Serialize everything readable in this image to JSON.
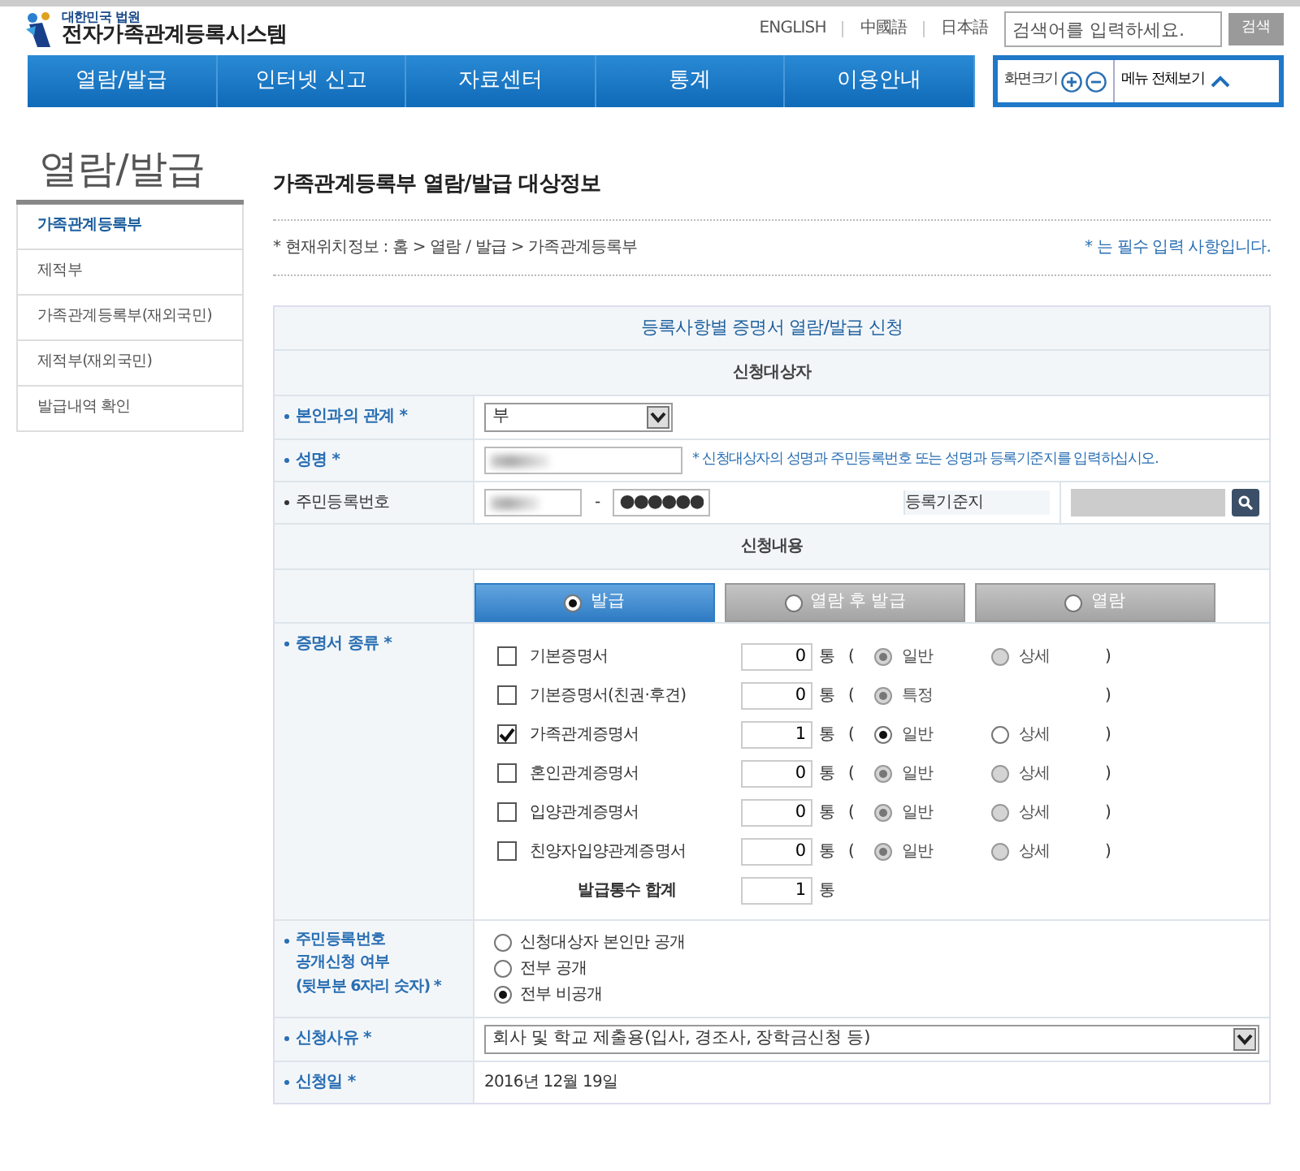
{
  "header": {
    "org": "대한민국 법원",
    "title": "전자가족관계등록시스템",
    "languages": [
      "ENGLISH",
      "中國語",
      "日本語"
    ],
    "search": {
      "placeholder": "검색어를 입력하세요.",
      "button": "검색"
    }
  },
  "nav": [
    "열람/발급",
    "인터넷 신고",
    "자료센터",
    "통계",
    "이용안내"
  ],
  "tools": {
    "zoom_label": "화면크기",
    "menu_label": "메뉴 전체보기"
  },
  "sidebar": {
    "title": "열람/발급",
    "items": [
      {
        "label": "가족관계등록부",
        "selected": true
      },
      {
        "label": "제적부",
        "selected": false
      },
      {
        "label": "가족관계등록부(재외국민)",
        "selected": false
      },
      {
        "label": "제적부(재외국민)",
        "selected": false
      },
      {
        "label": "발급내역 확인",
        "selected": false
      }
    ]
  },
  "page": {
    "title": "가족관계등록부 열람/발급 대상정보",
    "breadcrumb": "* 현재위치정보 : 홈 > 열람 / 발급 > 가족관계등록부",
    "required_note": "* 는 필수 입력 사항입니다."
  },
  "form": {
    "title": "등록사항별 증명서 열람/발급 신청",
    "section_subject": "신청대상자",
    "relation": {
      "label": "본인과의 관계 *",
      "required": true,
      "value": "부"
    },
    "name": {
      "label": "성명 *",
      "required": true,
      "hint": "* 신청대상자의 성명과 주민등록번호 또는 성명과 등록기준지를 입력하십시오."
    },
    "rrn": {
      "label": "주민등록번호",
      "required": false,
      "separator": "-",
      "back": "●●●●●●"
    },
    "domicile": {
      "label": "등록기준지",
      "required": false
    },
    "section_request": "신청내용",
    "modes": [
      {
        "label": "발급",
        "selected": true
      },
      {
        "label": "열람 후 발급",
        "selected": false
      },
      {
        "label": "열람",
        "selected": false
      }
    ],
    "certificates": {
      "label": "증명서 종류 *",
      "required": true,
      "rows": [
        {
          "label": "기본증명서",
          "checked": false,
          "count": "0",
          "unit": "통",
          "open": "(",
          "close": ")",
          "options": [
            {
              "label": "일반",
              "selected": true,
              "disabled": true
            },
            {
              "label": "상세",
              "selected": false,
              "disabled": true
            }
          ]
        },
        {
          "label": "기본증명서(친권·후견)",
          "checked": false,
          "count": "0",
          "unit": "통",
          "open": "(",
          "close": ")",
          "options": [
            {
              "label": "특정",
              "selected": true,
              "disabled": true
            }
          ]
        },
        {
          "label": "가족관계증명서",
          "checked": true,
          "count": "1",
          "unit": "통",
          "open": "(",
          "close": ")",
          "options": [
            {
              "label": "일반",
              "selected": true,
              "disabled": false
            },
            {
              "label": "상세",
              "selected": false,
              "disabled": false
            }
          ]
        },
        {
          "label": "혼인관계증명서",
          "checked": false,
          "count": "0",
          "unit": "통",
          "open": "(",
          "close": ")",
          "options": [
            {
              "label": "일반",
              "selected": true,
              "disabled": true
            },
            {
              "label": "상세",
              "selected": false,
              "disabled": true
            }
          ]
        },
        {
          "label": "입양관계증명서",
          "checked": false,
          "count": "0",
          "unit": "통",
          "open": "(",
          "close": ")",
          "options": [
            {
              "label": "일반",
              "selected": true,
              "disabled": true
            },
            {
              "label": "상세",
              "selected": false,
              "disabled": true
            }
          ]
        },
        {
          "label": "친양자입양관계증명서",
          "checked": false,
          "count": "0",
          "unit": "통",
          "open": "(",
          "close": ")",
          "options": [
            {
              "label": "일반",
              "selected": true,
              "disabled": true
            },
            {
              "label": "상세",
              "selected": false,
              "disabled": true
            }
          ]
        }
      ],
      "total": {
        "label": "발급통수 합계",
        "count": "1",
        "unit": "통"
      }
    },
    "disclosure": {
      "label": "주민등록번호\n공개신청 여부\n(뒷부분 6자리 숫자) *",
      "required": true,
      "options": [
        {
          "label": "신청대상자 본인만 공개",
          "selected": false
        },
        {
          "label": "전부 공개",
          "selected": false
        },
        {
          "label": "전부 비공개",
          "selected": true
        }
      ]
    },
    "reason": {
      "label": "신청사유 *",
      "required": true,
      "value": "회사 및 학교 제출용(입사, 경조사, 장학금신청 등)"
    },
    "date": {
      "label": "신청일 *",
      "required": true,
      "value": "2016년 12월 19일"
    }
  }
}
